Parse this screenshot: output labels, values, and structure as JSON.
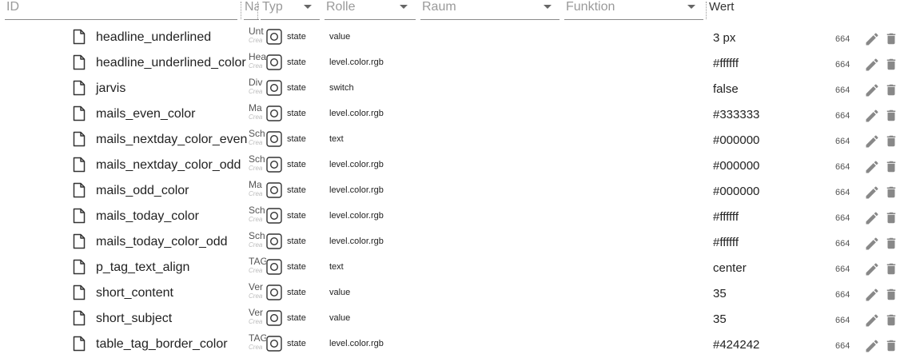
{
  "header": {
    "id_placeholder": "ID",
    "name_label": "Na",
    "type_label": "Typ",
    "role_label": "Rolle",
    "room_label": "Raum",
    "function_label": "Funktion",
    "value_label": "Wert"
  },
  "rows": [
    {
      "id": "headline_underlined",
      "name": "Unt",
      "name_sub": "Crea",
      "type": "state",
      "role": "value",
      "value": "3 px",
      "perm": "664"
    },
    {
      "id": "headline_underlined_color",
      "name": "Hea",
      "name_sub": "Crea",
      "type": "state",
      "role": "level.color.rgb",
      "value": "#ffffff",
      "perm": "664"
    },
    {
      "id": "jarvis",
      "name": "Div",
      "name_sub": "Crea",
      "type": "state",
      "role": "switch",
      "value": "false",
      "perm": "664"
    },
    {
      "id": "mails_even_color",
      "name": "Ma",
      "name_sub": "Crea",
      "type": "state",
      "role": "level.color.rgb",
      "value": "#333333",
      "perm": "664"
    },
    {
      "id": "mails_nextday_color_even",
      "name": "Sch",
      "name_sub": "Crea",
      "type": "state",
      "role": "text",
      "value": "#000000",
      "perm": "664"
    },
    {
      "id": "mails_nextday_color_odd",
      "name": "Sch",
      "name_sub": "Crea",
      "type": "state",
      "role": "level.color.rgb",
      "value": "#000000",
      "perm": "664"
    },
    {
      "id": "mails_odd_color",
      "name": "Ma",
      "name_sub": "Crea",
      "type": "state",
      "role": "level.color.rgb",
      "value": "#000000",
      "perm": "664"
    },
    {
      "id": "mails_today_color",
      "name": "Sch",
      "name_sub": "Crea",
      "type": "state",
      "role": "level.color.rgb",
      "value": "#ffffff",
      "perm": "664"
    },
    {
      "id": "mails_today_color_odd",
      "name": "Sch",
      "name_sub": "Crea",
      "type": "state",
      "role": "level.color.rgb",
      "value": "#ffffff",
      "perm": "664"
    },
    {
      "id": "p_tag_text_align",
      "name": "TAG",
      "name_sub": "Crea",
      "type": "state",
      "role": "text",
      "value": "center",
      "perm": "664"
    },
    {
      "id": "short_content",
      "name": "Ver",
      "name_sub": "Crea",
      "type": "state",
      "role": "value",
      "value": "35",
      "perm": "664"
    },
    {
      "id": "short_subject",
      "name": "Ver",
      "name_sub": "Crea",
      "type": "state",
      "role": "value",
      "value": "35",
      "perm": "664"
    },
    {
      "id": "table_tag_border_color",
      "name": "TAG",
      "name_sub": "Crea",
      "type": "state",
      "role": "level.color.rgb",
      "value": "#424242",
      "perm": "664"
    }
  ],
  "icons": {
    "file": "file-icon",
    "type": "state-type-icon",
    "edit": "pencil-icon",
    "delete": "trash-icon"
  },
  "colors": {
    "icon_gray": "#888888",
    "text": "#222222",
    "header_text": "#9a9a9a"
  }
}
